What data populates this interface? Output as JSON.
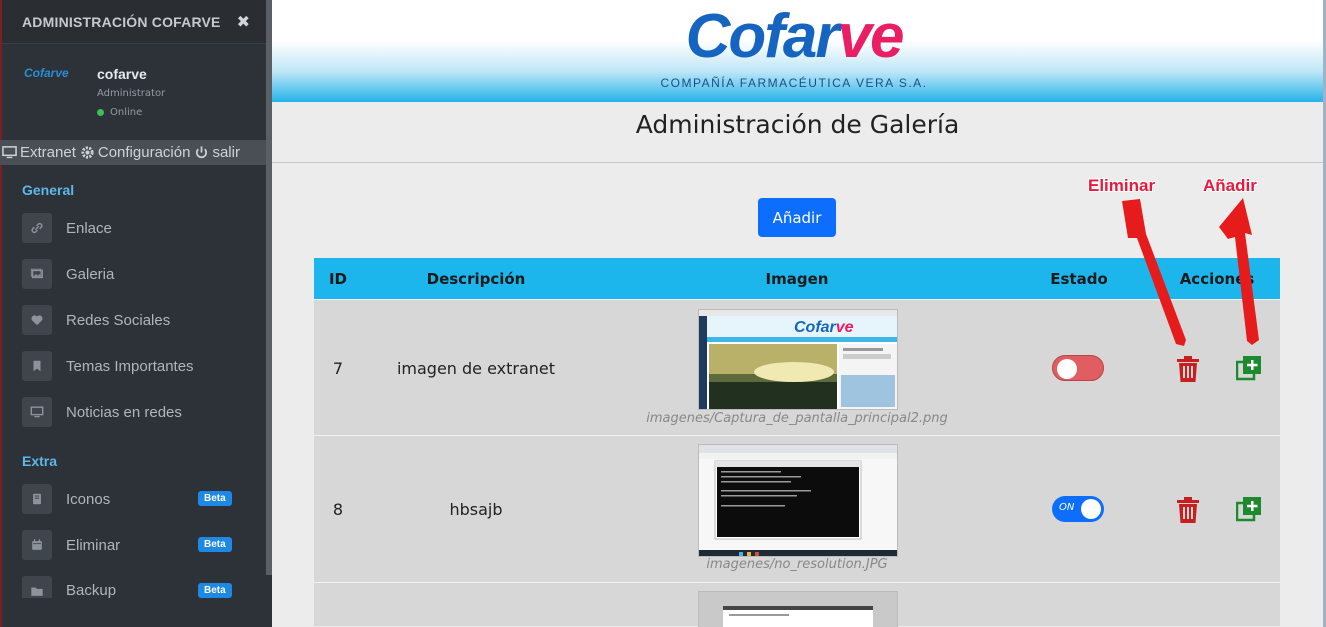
{
  "sidebar": {
    "title": "ADMINISTRACIÓN COFARVE",
    "user": {
      "logo_text": "Cofarve",
      "name": "cofarve",
      "role": "Administrator",
      "status": "Online"
    },
    "quick_links": [
      "Extranet",
      "Configuración",
      "salir"
    ],
    "sections": [
      {
        "title": "General",
        "items": [
          {
            "label": "Enlace",
            "icon": "link-icon"
          },
          {
            "label": "Galeria",
            "icon": "images-icon"
          },
          {
            "label": "Redes Sociales",
            "icon": "heart-icon"
          },
          {
            "label": "Temas Importantes",
            "icon": "bookmark-icon"
          },
          {
            "label": "Noticias en redes",
            "icon": "monitor-icon"
          }
        ]
      },
      {
        "title": "Extra",
        "items": [
          {
            "label": "Iconos",
            "icon": "book-icon",
            "badge": "Beta"
          },
          {
            "label": "Eliminar",
            "icon": "calendar-icon",
            "badge": "Beta"
          },
          {
            "label": "Backup",
            "icon": "folder-icon",
            "badge": "Beta"
          }
        ]
      }
    ]
  },
  "header": {
    "logo_main": "Cofar",
    "logo_accent": "ve",
    "logo_subtitle": "COMPAÑÍA FARMACÉUTICA VERA S.A."
  },
  "page": {
    "title": "Administración de Galería",
    "add_button": "Añadir",
    "annotations": {
      "delete": "Eliminar",
      "add": "Añadir"
    }
  },
  "table": {
    "columns": [
      "ID",
      "Descripción",
      "Imagen",
      "Estado",
      "Acciones"
    ],
    "rows": [
      {
        "id": "7",
        "description": "imagen de extranet",
        "image_path": "imagenes/Captura_de_pantalla_principal2.png",
        "status": "off",
        "status_label": ""
      },
      {
        "id": "8",
        "description": "hbsajb",
        "image_path": "imagenes/no_resolution.JPG",
        "status": "on",
        "status_label": "ON"
      }
    ]
  },
  "colors": {
    "accent": "#1cb5ec",
    "primary": "#0d6efd",
    "danger": "#c81e1e",
    "success": "#1e8a2e",
    "annotation": "#e8193d"
  }
}
